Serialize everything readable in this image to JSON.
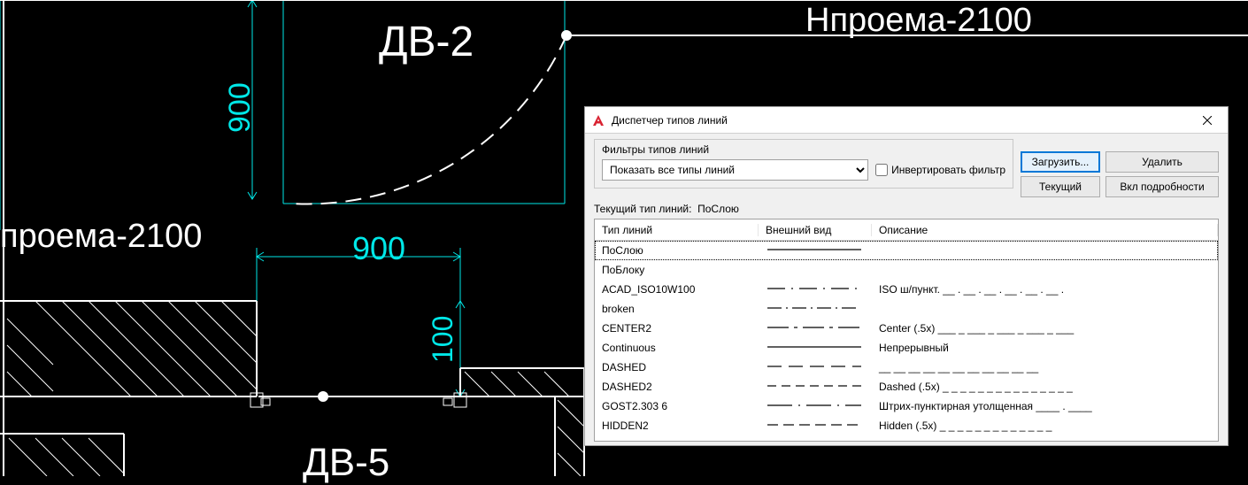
{
  "canvas": {
    "label_dv2": "ДВ-2",
    "label_dv5": "ДВ-5",
    "label_hproema_left": "проема-2100",
    "label_hproema_right": "Нпроема-2100",
    "dim_900_vert": "900",
    "dim_900_horiz": "900",
    "dim_100": "100"
  },
  "dialog": {
    "title": "Диспетчер типов линий",
    "filter_group_title": "Фильтры типов линий",
    "filter_dropdown": "Показать все типы линий",
    "invert_label": "Инвертировать фильтр",
    "buttons": {
      "load": "Загрузить...",
      "delete": "Удалить",
      "current": "Текущий",
      "details": "Вкл подробности"
    },
    "current_linetype_label": "Текущий тип линий:",
    "current_linetype_value": "ПоСлою",
    "columns": {
      "name": "Тип линий",
      "appearance": "Внешний вид",
      "description": "Описание"
    },
    "rows": [
      {
        "name": "ПоСлою",
        "desc": "",
        "pattern": "solid"
      },
      {
        "name": "ПоБлоку",
        "desc": "",
        "pattern": "none"
      },
      {
        "name": "ACAD_ISO10W100",
        "desc": "ISO ш/пункт. __ . __ . __ . __ . __ . __ .",
        "pattern": "dashdot"
      },
      {
        "name": "broken",
        "desc": "",
        "pattern": "dashdot2"
      },
      {
        "name": "CENTER2",
        "desc": "Center (.5x) ___ _ ___ _ ___ _ ___ _ ___",
        "pattern": "center2"
      },
      {
        "name": "Continuous",
        "desc": "Непрерывный",
        "pattern": "solid"
      },
      {
        "name": "DASHED",
        "desc": "__ __ __ __ __ __ __ __ __ __ __",
        "pattern": "dashed"
      },
      {
        "name": "DASHED2",
        "desc": "Dashed (.5x) _ _ _ _ _ _ _ _ _ _ _ _ _ _ _",
        "pattern": "dashed2"
      },
      {
        "name": "GOST2.303 6",
        "desc": "Штрих-пунктирная утолщенная ____ . ____",
        "pattern": "gost"
      },
      {
        "name": "HIDDEN2",
        "desc": "Hidden (.5x) _ _ _ _ _ _ _ _ _ _ _ _ _",
        "pattern": "hidden2"
      }
    ]
  }
}
